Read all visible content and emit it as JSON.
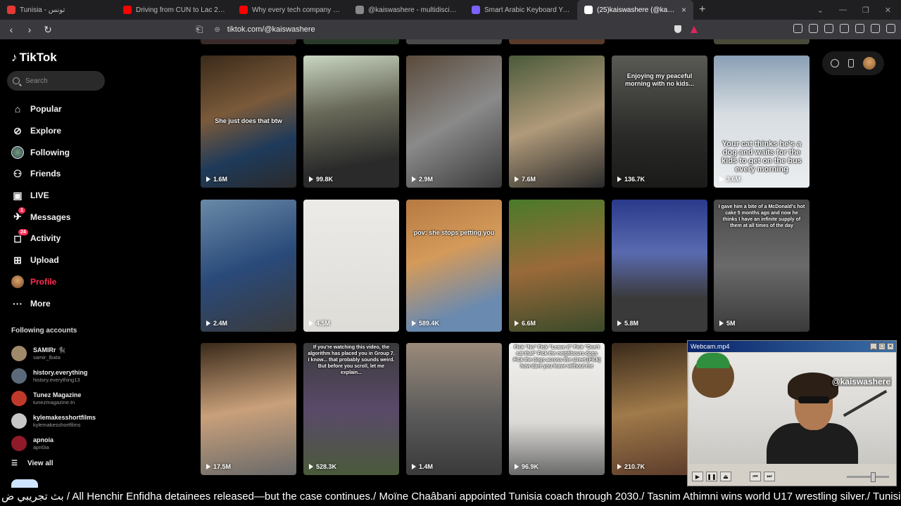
{
  "browser": {
    "tabs": [
      {
        "label": "Tunisia - تونس",
        "color": "#e53935",
        "active": false
      },
      {
        "label": "Driving from CUN to Lac 2 | Sun...",
        "color": "#ff0000",
        "active": false
      },
      {
        "label": "Why every tech company is hiring fo...",
        "color": "#ff0000",
        "active": false
      },
      {
        "label": "@kaiswashere - multidisciplinary dig",
        "color": "#888888",
        "active": false
      },
      {
        "label": "Smart Arabic Keyboard Yamli™",
        "color": "#7b61ff",
        "active": false
      },
      {
        "label": "(25)kaiswashere (@kaiswashere)",
        "color": "#ffffff",
        "active": true
      }
    ],
    "new_tab": "+",
    "url": "tiktok.com/@kaiswashere"
  },
  "sidebar": {
    "logo": "TikTok",
    "search_placeholder": "Search",
    "nav": [
      {
        "label": "Popular",
        "icon": "home-icon",
        "glyph": "⌂",
        "badge": ""
      },
      {
        "label": "Explore",
        "icon": "compass-icon",
        "glyph": "⊘",
        "badge": ""
      },
      {
        "label": "Following",
        "icon": "following-avatar-icon",
        "glyph": "●",
        "badge": ""
      },
      {
        "label": "Friends",
        "icon": "friends-icon",
        "glyph": "⚇",
        "badge": ""
      },
      {
        "label": "LIVE",
        "icon": "live-icon",
        "glyph": "▣",
        "badge": ""
      },
      {
        "label": "Messages",
        "icon": "messages-icon",
        "glyph": "✈",
        "badge": "1"
      },
      {
        "label": "Activity",
        "icon": "activity-icon",
        "glyph": "◻",
        "badge": "24"
      },
      {
        "label": "Upload",
        "icon": "upload-icon",
        "glyph": "⊞",
        "badge": ""
      },
      {
        "label": "Profile",
        "icon": "profile-avatar-icon",
        "glyph": "●",
        "badge": ""
      },
      {
        "label": "More",
        "icon": "more-icon",
        "glyph": "···",
        "badge": ""
      }
    ],
    "following_title": "Following accounts",
    "accounts": [
      {
        "name": "SAMIRr 🐈‍⬛",
        "handle": "samir_lbata",
        "color": "#a08a6a"
      },
      {
        "name": "history.everything",
        "handle": "history.everything13",
        "color": "#5a6a7a"
      },
      {
        "name": "Tunez Magazine",
        "handle": "tunezmagazine.tn",
        "color": "#c0392b"
      },
      {
        "name": "kylemakesshortfilms",
        "handle": "kylemakesshortfilms",
        "color": "#c7c7c7"
      },
      {
        "name": "apnoia",
        "handle": "apn0ia",
        "color": "#8e1a2a"
      }
    ],
    "view_all": "View all"
  },
  "grid": {
    "rows": [
      [
        {
          "caption": "She just does that btw",
          "views": "1.6M",
          "bg": "linear-gradient(160deg,#3b2a1a,#7a5a3a 40%,#1e3a5a 70%,#2a2a2a)"
        },
        {
          "caption": "",
          "views": "99.8K",
          "bg": "linear-gradient(170deg,#c9d6c2,#6a6a5a 40%,#2a2a2a 80%)"
        },
        {
          "caption": "",
          "views": "2.9M",
          "bg": "linear-gradient(150deg,#5a4a3a,#8a8a8a 50%,#3a3a3a)"
        },
        {
          "caption": "",
          "views": "7.6M",
          "bg": "linear-gradient(160deg,#4a5a3a,#b09a7a 50%,#2a2a2a)"
        },
        {
          "caption": "Enjoying my peaceful morning with no kids...",
          "views": "136.7K",
          "bg": "linear-gradient(180deg,#5a5a55,#2a2a28 60%,#1a1a18)"
        },
        {
          "caption": "Your cat thinks he's a dog and waits for the kids to get on the bus every morning",
          "views": "3.6M",
          "bg": "linear-gradient(180deg,#8aa0b5,#d8dde2 45%,#ebeef0)"
        }
      ],
      [
        {
          "caption": "",
          "views": "2.4M",
          "bg": "linear-gradient(160deg,#6a8aa8,#2a4a7a 50%,#3a3a3a)"
        },
        {
          "caption": "",
          "views": "4.5M",
          "bg": "linear-gradient(180deg,#ecebe8,#dedcd7)"
        },
        {
          "caption": "pov: she stops petting you",
          "views": "589.4K",
          "bg": "linear-gradient(160deg,#b67a42,#d49a5a 40%,#6a8ab0 80%)"
        },
        {
          "caption": "",
          "views": "6.6M",
          "bg": "linear-gradient(170deg,#4a7a2a,#9a6a3a 50%,#3a4a2a)"
        },
        {
          "caption": "",
          "views": "5.8M",
          "bg": "linear-gradient(180deg,#2a3a8a,#5a6ab0 40%,#3a3a3a 75%)"
        },
        {
          "caption": "I gave him a bite of a McDonald's hot cake 5 months ago and now he thinks I have an infinite supply of them at all times of the day",
          "views": "5M",
          "bg": "linear-gradient(180deg,#4a4a4a,#6a6a6a 50%,#3a3a3a)"
        }
      ],
      [
        {
          "caption": "",
          "views": "17.5M",
          "bg": "linear-gradient(170deg,#3a2a1a,#c9a07a 50%,#6a6a6a)"
        },
        {
          "caption": "If you're watching this video, the algorithm has placed you in Group 7. I know... that probably sounds weird. But before you scroll, let me explain...",
          "views": "528.3K",
          "bg": "linear-gradient(180deg,#3a3a3a,#5a4a6a 50%,#4a5a3a)"
        },
        {
          "caption": "",
          "views": "1.4M",
          "bg": "linear-gradient(180deg,#9a8a7a,#5a5a5a 55%,#3a3a3a)"
        },
        {
          "caption": "Fick \"No\" Fick \"Leave it\" Fick \"Don't eat that\" Fick the neighbours dogs Fick the dogs across the street [Fick] how dare you leave without me",
          "views": "96.9K",
          "bg": "linear-gradient(180deg,#f2f2f0,#dcdad6 60%,#6a6a6a)"
        },
        {
          "caption": "",
          "views": "210.7K",
          "bg": "linear-gradient(170deg,#3a2a1a,#a07a4a 50%,#5a3a2a)"
        }
      ]
    ]
  },
  "webcam": {
    "title": "Webcam.mp4",
    "handle": "@kaiswashere"
  },
  "ticker": {
    "prefix": "بث تجريبي ض",
    "text": " / All Henchir Enfidha detainees released—but the case continues./ Moïne Chaâbani appointed Tunisia coach through 2030./ Tasnim Athimni wins world U17 wrestling silver./ Tunisia–EU fight"
  }
}
